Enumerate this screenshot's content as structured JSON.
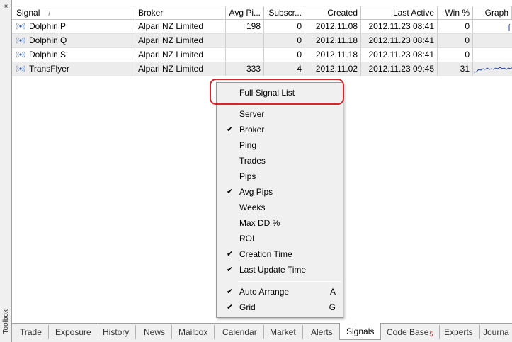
{
  "toolbox": {
    "label": "Toolbox",
    "close_glyph": "×"
  },
  "columns": {
    "signal": "Signal",
    "sort_glyph": "/",
    "broker": "Broker",
    "avg_pips": "Avg Pi...",
    "subscribers": "Subscr...",
    "created": "Created",
    "last_active": "Last Active",
    "win_pct": "Win %",
    "graph": "Graph"
  },
  "rows": [
    {
      "signal": "Dolphin P",
      "broker": "Alpari NZ Limited",
      "avg_pips": "198",
      "subscribers": "0",
      "created": "2012.11.08",
      "last_active": "2012.11.23 08:41",
      "win_pct": "0"
    },
    {
      "signal": "Dolphin Q",
      "broker": "Alpari NZ Limited",
      "avg_pips": "",
      "subscribers": "0",
      "created": "2012.11.18",
      "last_active": "2012.11.23 08:41",
      "win_pct": "0"
    },
    {
      "signal": "Dolphin S",
      "broker": "Alpari NZ Limited",
      "avg_pips": "",
      "subscribers": "0",
      "created": "2012.11.18",
      "last_active": "2012.11.23 08:41",
      "win_pct": "0"
    },
    {
      "signal": "TransFlyer",
      "broker": "Alpari NZ Limited",
      "avg_pips": "333",
      "subscribers": "4",
      "created": "2012.11.02",
      "last_active": "2012.11.23 09:45",
      "win_pct": "31"
    }
  ],
  "context_menu": {
    "full_signal_list": "Full Signal List",
    "server": "Server",
    "broker": "Broker",
    "ping": "Ping",
    "trades": "Trades",
    "pips": "Pips",
    "avg_pips": "Avg Pips",
    "weeks": "Weeks",
    "max_dd": "Max DD %",
    "roi": "ROI",
    "creation_time": "Creation Time",
    "last_update_time": "Last Update Time",
    "auto_arrange": "Auto Arrange",
    "auto_arrange_key": "A",
    "grid": "Grid",
    "grid_key": "G",
    "check_glyph": "✔"
  },
  "tabs": {
    "trade": "Trade",
    "exposure": "Exposure",
    "history": "History",
    "news": "News",
    "mailbox": "Mailbox",
    "calendar": "Calendar",
    "market": "Market",
    "alerts": "Alerts",
    "signals": "Signals",
    "code_base": "Code Base",
    "code_base_badge": "5",
    "experts": "Experts",
    "journal": "Journa"
  },
  "colors": {
    "highlight_ring": "#d9232b",
    "signal_icon": "#3a5ea8",
    "sparkline": "#1c3fa0"
  }
}
